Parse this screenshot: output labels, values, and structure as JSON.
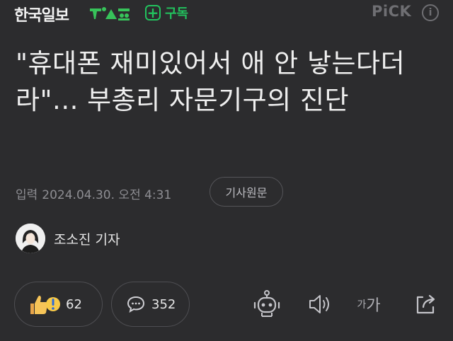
{
  "header": {
    "publisher": "한국일보",
    "subscribe_label": "구독",
    "pick_label": "PiCK",
    "info_symbol": "i"
  },
  "article": {
    "headline": "\"휴대폰 재미있어서 애 안 낳는다더라\"... 부총리 자문기구의 진단",
    "published_label": "입력",
    "published_at": "2024.04.30. 오전 4:31",
    "original_link_label": "기사원문",
    "reporter": "조소진 기자"
  },
  "actions": {
    "reaction_count": "62",
    "comment_count": "352",
    "font_small": "가",
    "font_large": "가"
  },
  "colors": {
    "background": "#2c2c2e",
    "accent_green": "#22c35e",
    "muted": "#8e8e93"
  }
}
